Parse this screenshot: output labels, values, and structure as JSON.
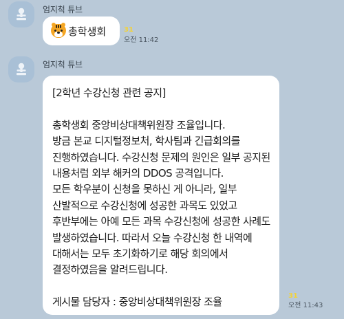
{
  "messages": [
    {
      "sender": "엄지척 튜브",
      "emoji_icon": "tiger-face-icon",
      "text": "총학생회",
      "unread": "31",
      "time": "오전 11:42"
    },
    {
      "sender": "엄지척 튜브",
      "title": "[2학년 수강신청 관련 공지]",
      "paragraphs": [
        "총학생회 중앙비상대책위원장 조율입니다.\n방금 본교 디지털정보처, 학사팀과 긴급회의를 진행하였습니다. 수강신청 문제의 원인은 일부 공지된 내용처럼 외부 해커의 DDOS 공격입니다.",
        "모든 학우분이 신청을 못하신 게 아니라, 일부 산발적으로 수강신청에 성공한 과목도 있었고 후반부에는 아예 모든 과목 수강신청에 성공한 사례도 발생하였습니다. 따라서 오늘 수강신청 한 내역에 대해서는 모두 초기화하기로 해당 회의에서 결정하였음을 알려드립니다.",
        "게시물 담당자 : 중앙비상대책위원장 조율"
      ],
      "unread": "31",
      "time": "오전 11:43"
    }
  ],
  "colors": {
    "background": "#b9c9d8",
    "bubble": "#ffffff",
    "avatar": "#a9c0d6",
    "unread": "#f2d23a"
  }
}
